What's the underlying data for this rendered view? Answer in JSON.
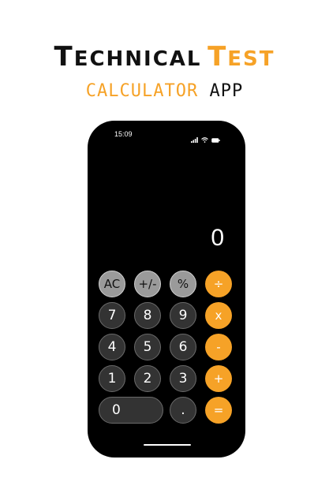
{
  "header": {
    "title_word1": "Technical",
    "title_word2": "Test",
    "subtitle_word1": "CALCULATOR",
    "subtitle_word2": "APP"
  },
  "status_bar": {
    "time": "15:09"
  },
  "display": {
    "value": "0"
  },
  "keys": {
    "ac": "AC",
    "sign": "+/-",
    "percent": "%",
    "divide": "÷",
    "seven": "7",
    "eight": "8",
    "nine": "9",
    "multiply": "x",
    "four": "4",
    "five": "5",
    "six": "6",
    "minus": "-",
    "one": "1",
    "two": "2",
    "three": "3",
    "plus": "+",
    "zero": "0",
    "decimal": ".",
    "equals": "="
  },
  "colors": {
    "accent": "#f6a227",
    "function_key": "#9a9a9a",
    "number_key": "#333333",
    "phone_bg": "#000000"
  }
}
